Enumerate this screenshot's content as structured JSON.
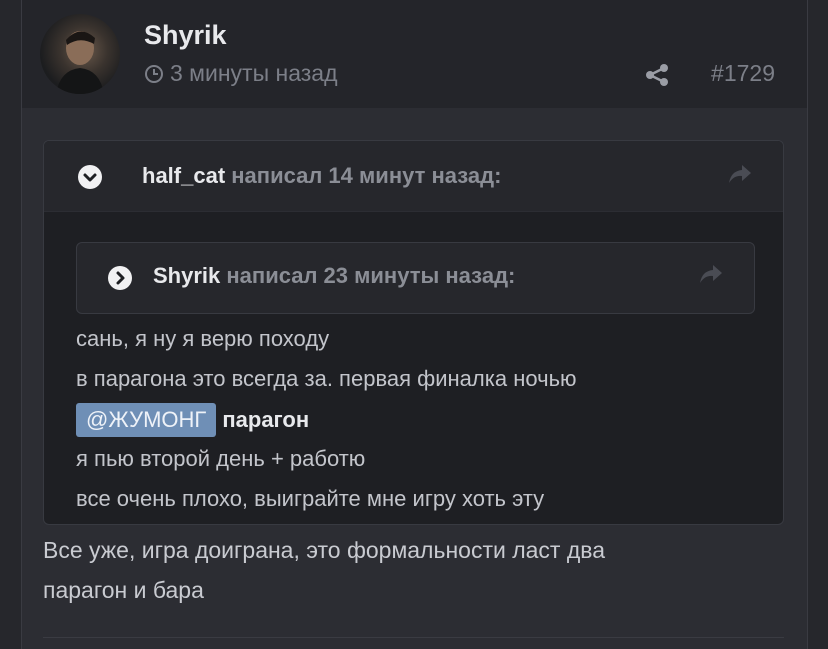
{
  "post": {
    "author": "Shyrik",
    "time_ago": "3 минуты назад",
    "post_number": "#1729",
    "reply": {
      "lines": [
        "Все уже, игра доиграна, это формальности ласт два",
        "парагон и бара"
      ]
    }
  },
  "quote_outer": {
    "author": "half_cat",
    "meta": " написал 14 минут назад:",
    "lines": [
      "сань, я ну я верю походу",
      "в парагона это всегда за. первая финалка ночью"
    ],
    "mention": "@ЖУМОНГ",
    "mention_suffix": "парагон",
    "lines_after": [
      "я пью второй день + работю",
      "все очень плохо, выиграйте мне игру хоть эту"
    ]
  },
  "quote_inner": {
    "author": "Shyrik",
    "meta": " написал 23 минуты назад:"
  },
  "colors": {
    "background": "#26272c",
    "card": "#2c2d33",
    "mention": "#6f8fb6"
  },
  "icons": [
    "clock-icon",
    "share-icon",
    "chevron-down-icon",
    "chevron-right-icon",
    "reply-arrow-icon"
  ]
}
